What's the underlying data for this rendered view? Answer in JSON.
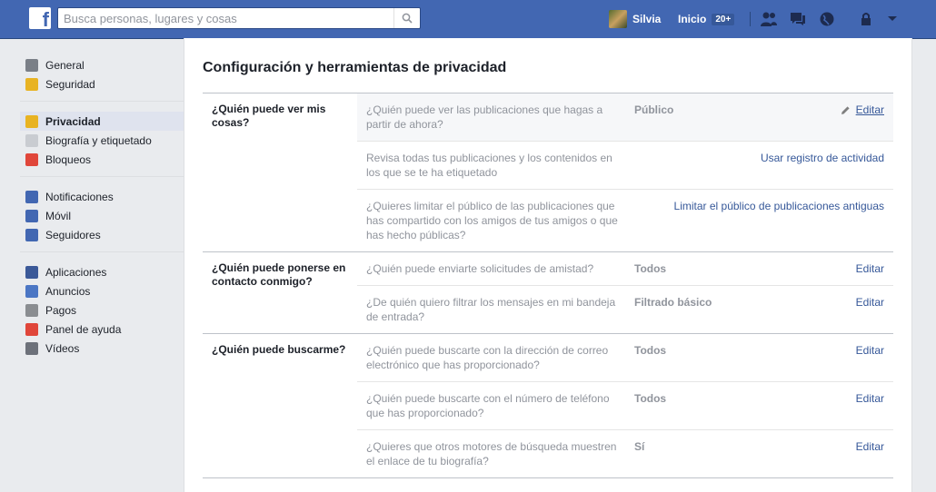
{
  "topbar": {
    "logo": "f",
    "search_placeholder": "Busca personas, lugares y cosas",
    "profile_name": "Silvia",
    "home_label": "Inicio",
    "home_badge": "20+"
  },
  "sidebar": {
    "groups": [
      [
        {
          "label": "General",
          "icon": "gear-icon",
          "color": "#7a7f87"
        },
        {
          "label": "Seguridad",
          "icon": "shield-icon",
          "color": "#e8b323"
        }
      ],
      [
        {
          "label": "Privacidad",
          "icon": "lock-icon",
          "color": "#e8b323",
          "selected": true
        },
        {
          "label": "Biografía y etiquetado",
          "icon": "timeline-icon",
          "color": "#c9ccd1"
        },
        {
          "label": "Bloqueos",
          "icon": "block-icon",
          "color": "#e0463a"
        }
      ],
      [
        {
          "label": "Notificaciones",
          "icon": "globe-icon",
          "color": "#4267b2"
        },
        {
          "label": "Móvil",
          "icon": "mobile-icon",
          "color": "#4267b2"
        },
        {
          "label": "Seguidores",
          "icon": "rss-icon",
          "color": "#4267b2"
        }
      ],
      [
        {
          "label": "Aplicaciones",
          "icon": "apps-icon",
          "color": "#3b5998"
        },
        {
          "label": "Anuncios",
          "icon": "ads-icon",
          "color": "#4b76c4"
        },
        {
          "label": "Pagos",
          "icon": "card-icon",
          "color": "#8a8d91"
        },
        {
          "label": "Panel de ayuda",
          "icon": "lifebuoy-icon",
          "color": "#e0463a"
        },
        {
          "label": "Vídeos",
          "icon": "video-icon",
          "color": "#6d717a"
        }
      ]
    ]
  },
  "main": {
    "title": "Configuración y herramientas de privacidad",
    "sections": [
      {
        "label": "¿Quién puede ver mis cosas?",
        "rows": [
          {
            "question": "¿Quién puede ver las publicaciones que hagas a partir de ahora?",
            "value": "Público",
            "action": "Editar",
            "highlight": true,
            "pencil": true
          },
          {
            "question": "Revisa todas tus publicaciones y los contenidos en los que se te ha etiquetado",
            "value": "",
            "action": "Usar registro de actividad"
          },
          {
            "question": "¿Quieres limitar el público de las publicaciones que has compartido con los amigos de tus amigos o que has hecho públicas?",
            "value": "",
            "action": "Limitar el público de publicaciones antiguas"
          }
        ]
      },
      {
        "label": "¿Quién puede ponerse en contacto conmigo?",
        "rows": [
          {
            "question": "¿Quién puede enviarte solicitudes de amistad?",
            "value": "Todos",
            "action": "Editar"
          },
          {
            "question": "¿De quién quiero filtrar los mensajes en mi bandeja de entrada?",
            "value": "Filtrado básico",
            "action": "Editar"
          }
        ]
      },
      {
        "label": "¿Quién puede buscarme?",
        "rows": [
          {
            "question": "¿Quién puede buscarte con la dirección de correo electrónico que has proporcionado?",
            "value": "Todos",
            "action": "Editar"
          },
          {
            "question": "¿Quién puede buscarte con el número de teléfono que has proporcionado?",
            "value": "Todos",
            "action": "Editar"
          },
          {
            "question": "¿Quieres que otros motores de búsqueda muestren el enlace de tu biografía?",
            "value": "Sí",
            "action": "Editar"
          }
        ]
      }
    ]
  }
}
